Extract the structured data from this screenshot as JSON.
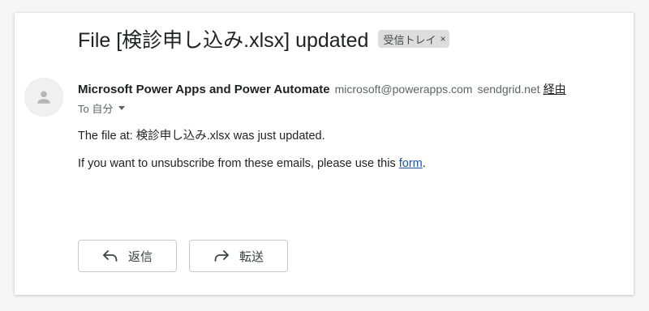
{
  "email": {
    "subject": "File [検診申し込み.xlsx] updated",
    "label": "受信トレイ",
    "label_close": "×",
    "sender_name": "Microsoft Power Apps and Power Automate",
    "sender_email": "microsoft@powerapps.com",
    "relay_domain": "sendgrid.net",
    "via_label": "経由",
    "to_label": "To 自分",
    "body_line1": "The file at: 検診申し込み.xlsx was just updated.",
    "body_line2_prefix": "If you want to unsubscribe from these emails, please use this ",
    "body_link": "form",
    "body_line2_suffix": "."
  },
  "actions": {
    "reply_label": "返信",
    "forward_label": "転送"
  },
  "icons": {
    "avatar": "person-icon",
    "reply": "reply-arrow-icon",
    "forward": "forward-arrow-icon",
    "dropdown": "caret-down-icon"
  },
  "colors": {
    "link": "#1a53b0",
    "label_bg": "#dddddd"
  }
}
